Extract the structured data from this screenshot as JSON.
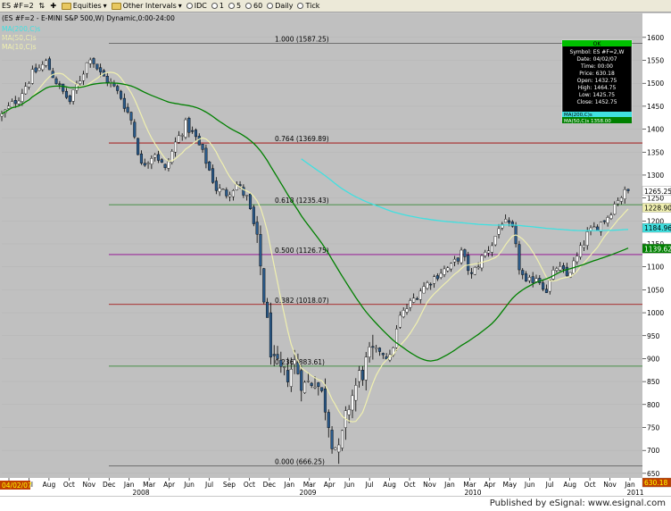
{
  "toolbar": {
    "symbol": "ES #F=2",
    "equities": "Equities",
    "other_intervals": "Other Intervals",
    "intervals": [
      "IDC",
      "1",
      "5",
      "60",
      "Daily",
      "Tick"
    ]
  },
  "chart_title": "(ES #F=2 - E-MINI S&P 500,W) Dynamic,0:00-24:00",
  "legend": [
    {
      "label": "MA(200,C)s",
      "color": "#00e0e0"
    },
    {
      "label": "MA(50,C)s",
      "color": "#e8e8a0"
    },
    {
      "label": "MA(10,C)s",
      "color": "#e8e8a0"
    }
  ],
  "colors": {
    "background": "#c0c0c0",
    "up": "#ffffff",
    "down": "#2a5a8a",
    "ma10": "#f0f0b0",
    "ma50": "#008000",
    "ma200": "#40e0e0",
    "fib": "#800000"
  },
  "fib_levels": [
    {
      "label": "1.000 (1587.25)",
      "value": 1587.25,
      "color": "#555555"
    },
    {
      "label": "0.764 (1369.89)",
      "value": 1369.89,
      "color": "#a00000"
    },
    {
      "label": "0.618 (1235.43)",
      "value": 1235.43,
      "color": "#208020"
    },
    {
      "label": "0.500 (1126.75)",
      "value": 1126.75,
      "color": "#900090"
    },
    {
      "label": "0.382 (1018.07)",
      "value": 1018.07,
      "color": "#a00000"
    },
    {
      "label": "0.236 (883.61)",
      "value": 883.61,
      "color": "#208020"
    },
    {
      "label": "0.000 (666.25)",
      "value": 666.25,
      "color": "#555555"
    }
  ],
  "data_window": {
    "header": "OK",
    "rows": [
      {
        "k": "Symbol",
        "v": "ES #F=2,W"
      },
      {
        "k": "Date",
        "v": "04/02/07"
      },
      {
        "k": "Time",
        "v": "00:00"
      },
      {
        "k": "Price",
        "v": "630.18"
      },
      {
        "k": "Open",
        "v": "1432.75"
      },
      {
        "k": "High",
        "v": "1464.75"
      },
      {
        "k": "Low",
        "v": "1425.75"
      },
      {
        "k": "Close",
        "v": "1452.75"
      }
    ],
    "ma200": "MA(200,C)s",
    "ma50": "MA(50,C)s 1358.00"
  },
  "price_tags": {
    "close": "1265.25",
    "ma10": "1228.90",
    "ma200": "1184.96",
    "ma50": "1139.62",
    "cursor": "630.18"
  },
  "date_tag": "04/02/07",
  "chart_data": {
    "type": "candlestick",
    "ylim": [
      640,
      1625
    ],
    "y_ticks": [
      650,
      700,
      750,
      800,
      850,
      900,
      950,
      1000,
      1050,
      1100,
      1150,
      1200,
      1250,
      1300,
      1350,
      1400,
      1450,
      1500,
      1550,
      1600
    ],
    "x_month_labels": [
      "Jun",
      "Jul",
      "Aug",
      "Oct",
      "Nov",
      "Dec",
      "Jan",
      "Mar",
      "Apr",
      "Jun",
      "Jul",
      "Sep",
      "Oct",
      "Dec",
      "Jan",
      "Mar",
      "Apr",
      "Jun",
      "Jul",
      "Aug",
      "Oct",
      "Nov",
      "Jan",
      "Mar",
      "Apr",
      "May",
      "Jun",
      "Jul",
      "Aug",
      "Oct",
      "Nov",
      "Jan"
    ],
    "x_year_labels": [
      "2008",
      "2009",
      "2010",
      "2011"
    ],
    "anchors": [
      {
        "w": 0,
        "p": 1430
      },
      {
        "w": 5,
        "p": 1470
      },
      {
        "w": 9,
        "p": 1520
      },
      {
        "w": 13,
        "p": 1545
      },
      {
        "w": 17,
        "p": 1490
      },
      {
        "w": 20,
        "p": 1460
      },
      {
        "w": 23,
        "p": 1510
      },
      {
        "w": 26,
        "p": 1560
      },
      {
        "w": 29,
        "p": 1520
      },
      {
        "w": 32,
        "p": 1500
      },
      {
        "w": 35,
        "p": 1470
      },
      {
        "w": 38,
        "p": 1420
      },
      {
        "w": 41,
        "p": 1320
      },
      {
        "w": 45,
        "p": 1350
      },
      {
        "w": 48,
        "p": 1310
      },
      {
        "w": 51,
        "p": 1370
      },
      {
        "w": 54,
        "p": 1410
      },
      {
        "w": 57,
        "p": 1380
      },
      {
        "w": 60,
        "p": 1330
      },
      {
        "w": 63,
        "p": 1270
      },
      {
        "w": 66,
        "p": 1260
      },
      {
        "w": 69,
        "p": 1280
      },
      {
        "w": 72,
        "p": 1250
      },
      {
        "w": 74,
        "p": 1190
      },
      {
        "w": 76,
        "p": 1100
      },
      {
        "w": 78,
        "p": 970
      },
      {
        "w": 80,
        "p": 880
      },
      {
        "w": 83,
        "p": 860
      },
      {
        "w": 86,
        "p": 890
      },
      {
        "w": 89,
        "p": 840
      },
      {
        "w": 92,
        "p": 860
      },
      {
        "w": 95,
        "p": 800
      },
      {
        "w": 97,
        "p": 730
      },
      {
        "w": 99,
        "p": 690
      },
      {
        "w": 102,
        "p": 800
      },
      {
        "w": 105,
        "p": 860
      },
      {
        "w": 108,
        "p": 900
      },
      {
        "w": 111,
        "p": 920
      },
      {
        "w": 114,
        "p": 900
      },
      {
        "w": 117,
        "p": 990
      },
      {
        "w": 120,
        "p": 1020
      },
      {
        "w": 123,
        "p": 1050
      },
      {
        "w": 126,
        "p": 1070
      },
      {
        "w": 129,
        "p": 1090
      },
      {
        "w": 132,
        "p": 1100
      },
      {
        "w": 135,
        "p": 1130
      },
      {
        "w": 138,
        "p": 1080
      },
      {
        "w": 141,
        "p": 1120
      },
      {
        "w": 144,
        "p": 1150
      },
      {
        "w": 147,
        "p": 1200
      },
      {
        "w": 150,
        "p": 1180
      },
      {
        "w": 152,
        "p": 1100
      },
      {
        "w": 154,
        "p": 1060
      },
      {
        "w": 157,
        "p": 1080
      },
      {
        "w": 160,
        "p": 1050
      },
      {
        "w": 163,
        "p": 1100
      },
      {
        "w": 166,
        "p": 1080
      },
      {
        "w": 169,
        "p": 1120
      },
      {
        "w": 172,
        "p": 1170
      },
      {
        "w": 175,
        "p": 1190
      },
      {
        "w": 178,
        "p": 1210
      },
      {
        "w": 181,
        "p": 1250
      },
      {
        "w": 184,
        "p": 1265
      }
    ],
    "x_weeks": [
      0,
      184
    ]
  }
}
